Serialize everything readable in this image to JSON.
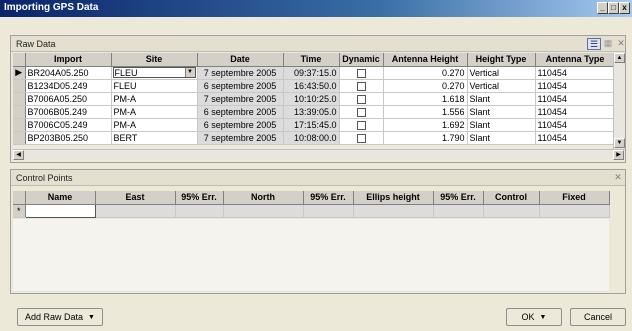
{
  "window": {
    "title": "Importing GPS Data"
  },
  "title_buttons": {
    "minimize": "_",
    "maximize": "□",
    "close": "x"
  },
  "raw_panel": {
    "title": "Raw Data",
    "columns": [
      "Import",
      "Site",
      "Date",
      "Time",
      "Dynamic",
      "Antenna Height",
      "Height Type",
      "Antenna Type"
    ],
    "rows": [
      {
        "import": "BR204A05.250",
        "site": "FLEU",
        "date": "7 septembre 2005",
        "time": "09:37:15.0",
        "dynamic": false,
        "antenna_height": "0.270",
        "height_type": "Vertical",
        "antenna_type": "110454"
      },
      {
        "import": "B1234D05.249",
        "site": "FLEU",
        "date": "6 septembre 2005",
        "time": "16:43:50.0",
        "dynamic": false,
        "antenna_height": "0.270",
        "height_type": "Vertical",
        "antenna_type": "110454"
      },
      {
        "import": "B7006A05.250",
        "site": "PM-A",
        "date": "7 septembre 2005",
        "time": "10:10:25.0",
        "dynamic": false,
        "antenna_height": "1.618",
        "height_type": "Slant",
        "antenna_type": "110454"
      },
      {
        "import": "B7006B05.249",
        "site": "PM-A",
        "date": "6 septembre 2005",
        "time": "13:39:05.0",
        "dynamic": false,
        "antenna_height": "1.556",
        "height_type": "Slant",
        "antenna_type": "110454"
      },
      {
        "import": "B7006C05.249",
        "site": "PM-A",
        "date": "6 septembre 2005",
        "time": "17:15:45.0",
        "dynamic": false,
        "antenna_height": "1.692",
        "height_type": "Slant",
        "antenna_type": "110454"
      },
      {
        "import": "BP203B05.250",
        "site": "BERT",
        "date": "7 septembre 2005",
        "time": "10:08:00.0",
        "dynamic": false,
        "antenna_height": "1.790",
        "height_type": "Slant",
        "antenna_type": "110454"
      }
    ]
  },
  "control_panel": {
    "title": "Control Points",
    "columns": [
      "Name",
      "East",
      "95% Err.",
      "North",
      "95% Err.",
      "Ellips height",
      "95% Err.",
      "Control",
      "Fixed"
    ],
    "new_row_marker": "*"
  },
  "footer": {
    "add_raw_data": "Add Raw Data",
    "ok": "OK",
    "cancel": "Cancel"
  }
}
